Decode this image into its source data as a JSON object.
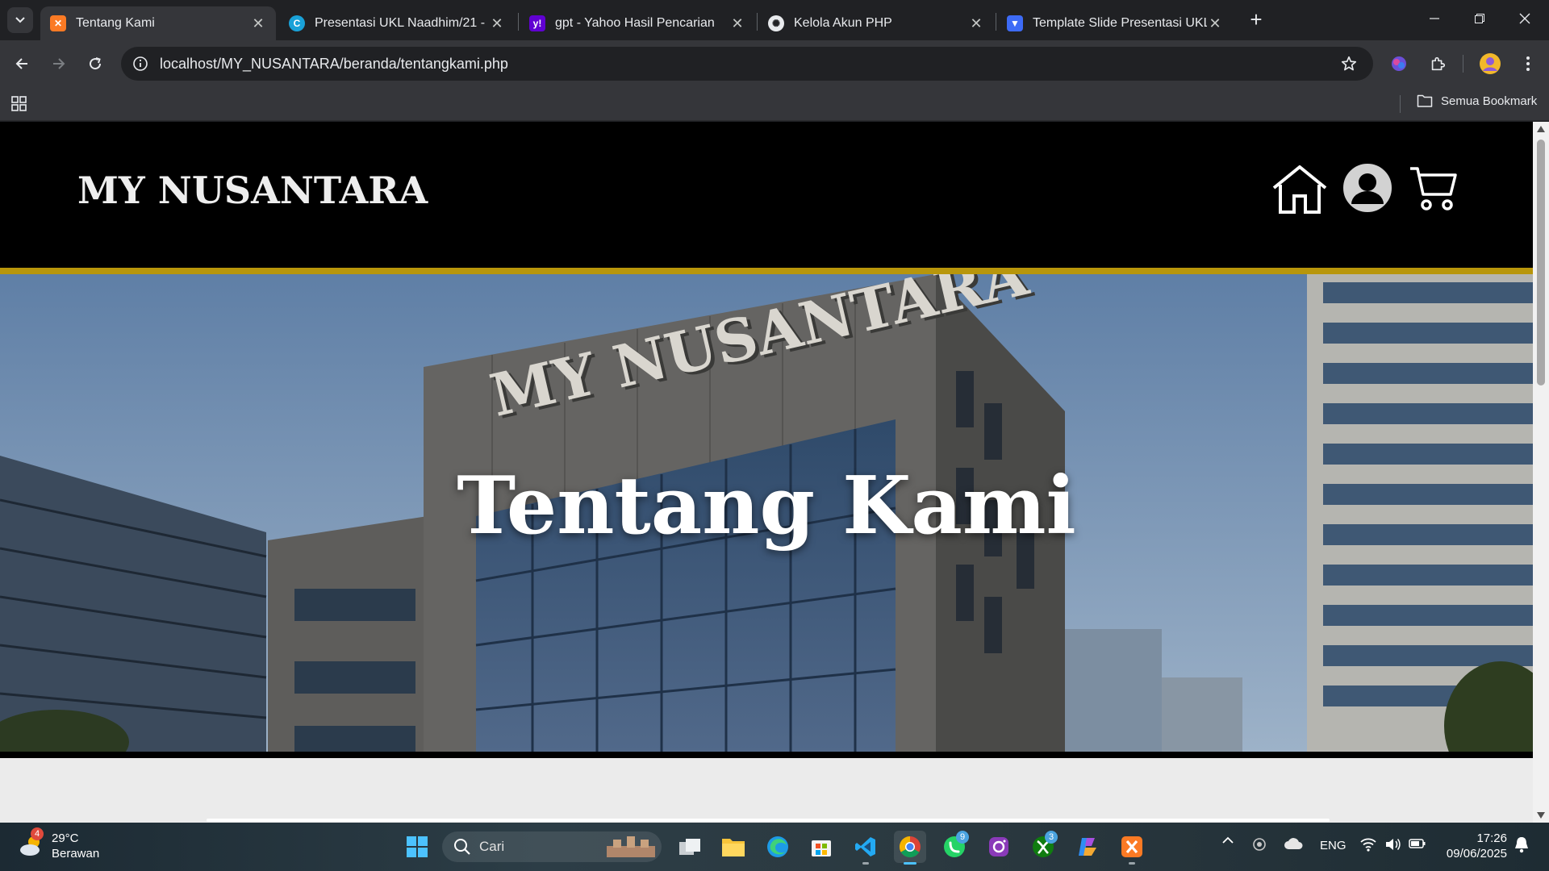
{
  "browser": {
    "tabs": [
      {
        "title": "Tentang Kami",
        "active": true,
        "favicon": "xampp-icon"
      },
      {
        "title": "Presentasi UKL Naadhim/21 - P",
        "active": false,
        "favicon": "canva-icon"
      },
      {
        "title": "gpt - Yahoo Hasil Pencarian",
        "active": false,
        "favicon": "yahoo-icon"
      },
      {
        "title": "Kelola Akun PHP",
        "active": false,
        "favicon": "chatgpt-icon"
      },
      {
        "title": "Template Slide Presentasi UKL",
        "active": false,
        "favicon": "slidesgo-icon"
      }
    ],
    "url": "localhost/MY_NUSANTARA/beranda/tentangkami.php",
    "bookmarks": {
      "all_label": "Semua Bookmark"
    }
  },
  "site": {
    "logo": "MY NUSANTARA",
    "hero_sign": "MY NUSANTARA",
    "hero_title": "Tentang Kami",
    "header_icons": [
      "home-icon",
      "user-icon",
      "cart-icon"
    ]
  },
  "taskbar": {
    "weather": {
      "temp": "29°C",
      "condition": "Berawan",
      "badge": "4"
    },
    "search_placeholder": "Cari",
    "badges": {
      "whatsapp": "9",
      "xbox": "3"
    },
    "language": "ENG",
    "time": "17:26",
    "date": "09/06/2025"
  },
  "colors": {
    "accent_gold": "#b8960b",
    "header_bg": "#000000",
    "browser_bg": "#202124"
  }
}
